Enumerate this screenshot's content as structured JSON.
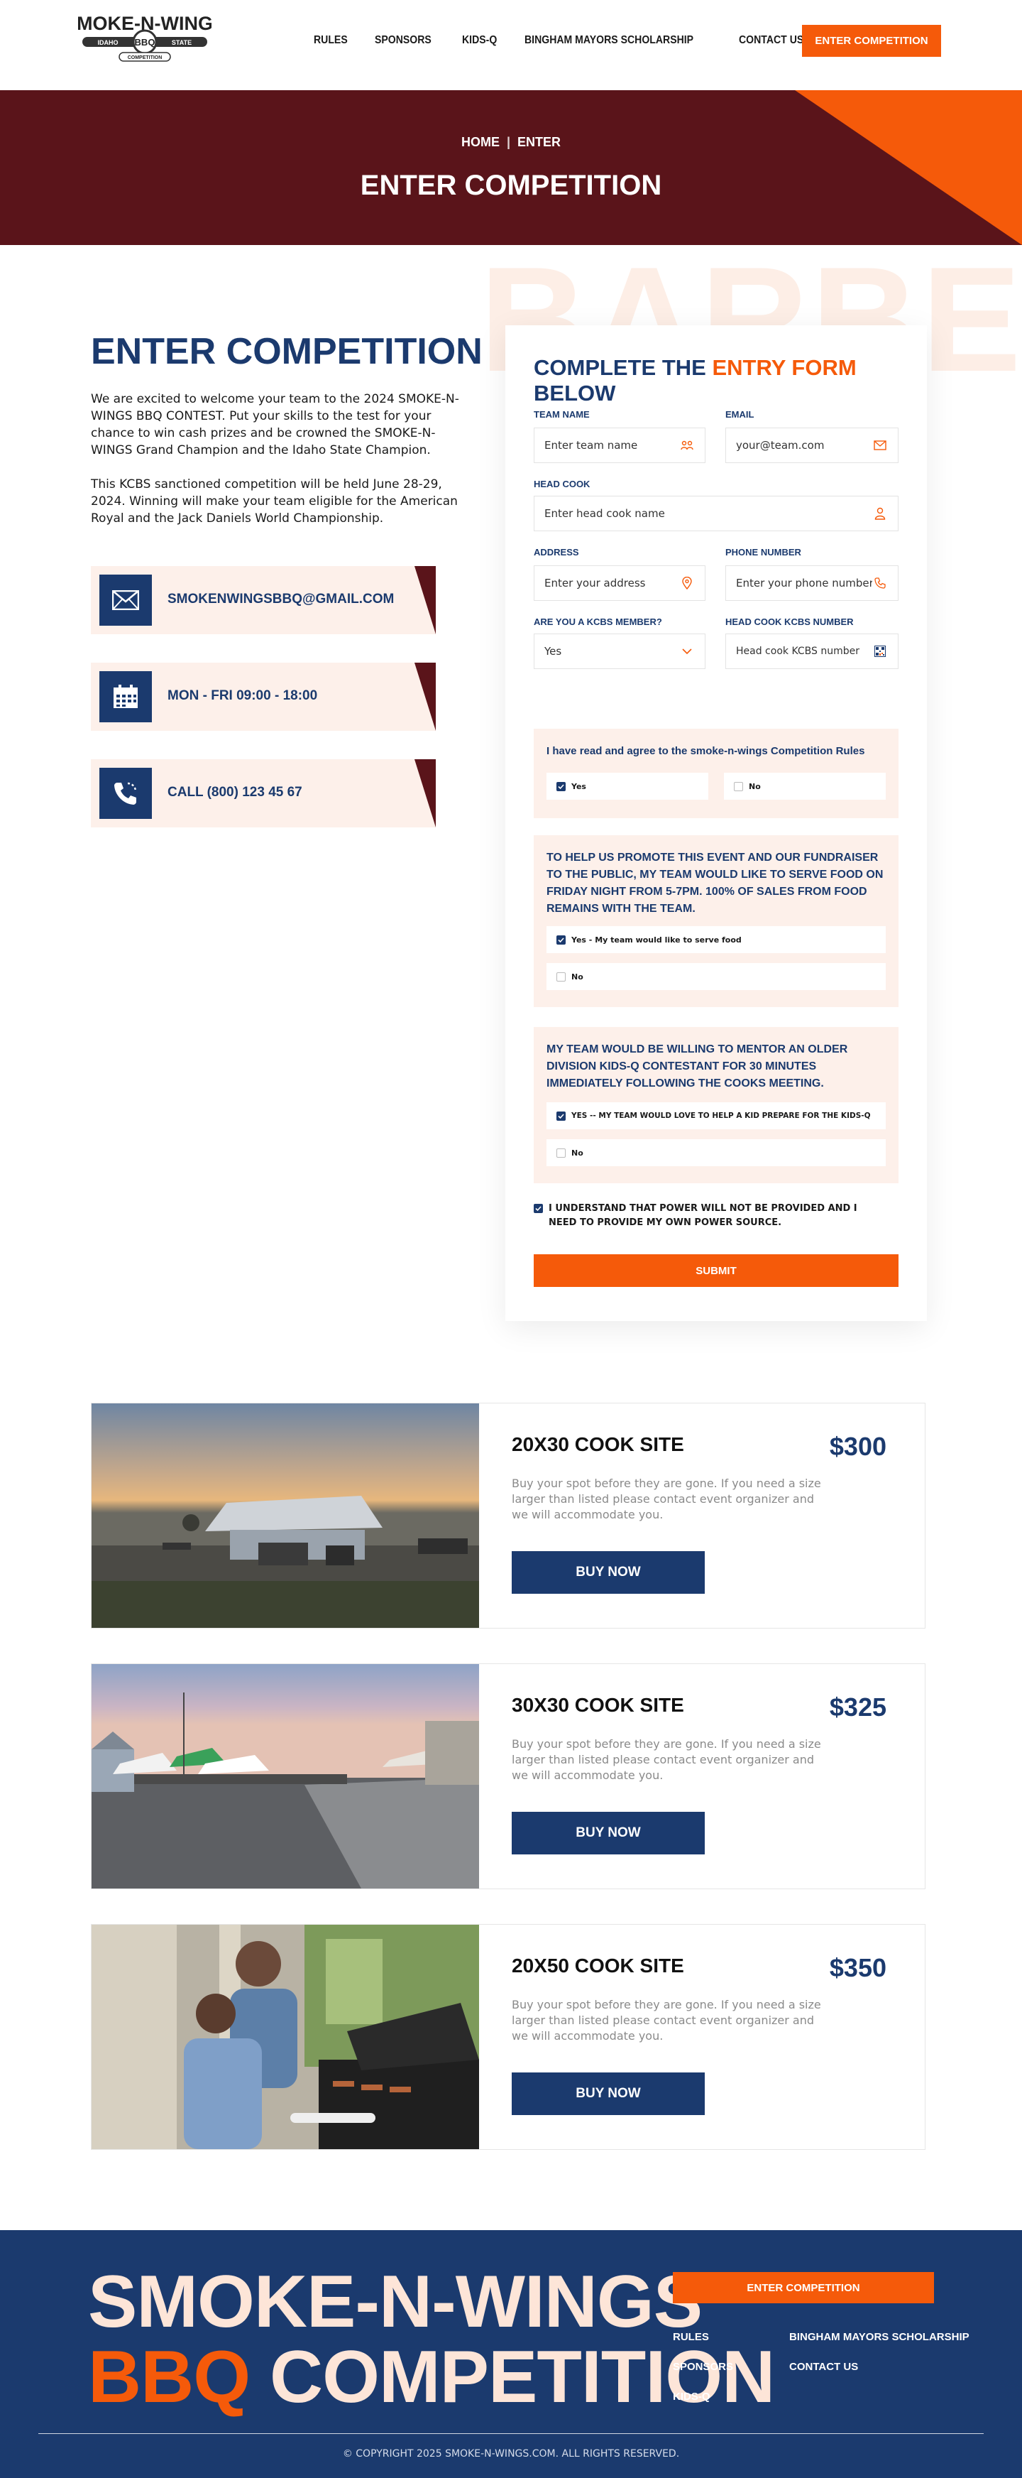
{
  "header": {
    "logo_text": "SMOKE-N-WINGS",
    "logo_sub_left": "IDAHO",
    "logo_sub_center": "BBQ",
    "logo_sub_right": "STATE",
    "logo_sub_bottom": "COMPETITION",
    "nav": [
      "RULES",
      "SPONSORS",
      "KIDS-Q",
      "BINGHAM MAYORS SCHOLARSHIP",
      "CONTACT US"
    ],
    "cta": "ENTER COMPETITION"
  },
  "hero": {
    "crumb_home": "HOME",
    "crumb_sep": "|",
    "crumb_current": "ENTER",
    "title": "ENTER COMPETITION"
  },
  "watermark": "BARBECUE",
  "left": {
    "title": "ENTER COMPETITION",
    "p1": "We are excited to welcome your team to the 2024 SMOKE-N-WINGS BBQ CONTEST. Put your skills to the test for your chance to win cash prizes and be crowned the SMOKE-N-WINGS Grand Champion and the Idaho State Champion.",
    "p2": "This KCBS sanctioned competition will be held June 28-29, 2024. Winning will make your team eligible for the American Royal and the Jack Daniels World Championship.",
    "email": "SMOKENWINGSBBQ@GMAIL.COM",
    "hours": "MON - FRI 09:00 - 18:00",
    "phone": "CALL (800) 123 45 67"
  },
  "form": {
    "title_a": "COMPLETE THE ",
    "title_b": "ENTRY FORM",
    "title_c": " BELOW",
    "team_name_label": "TEAM NAME",
    "team_name_ph": "Enter team name",
    "email_label": "EMAIL",
    "email_ph": "your@team.com",
    "head_cook_label": "HEAD COOK",
    "head_cook_ph": "Enter head cook name",
    "address_label": "ADDRESS",
    "address_ph": "Enter your address",
    "phone_label": "PHONE NUMBER",
    "phone_ph": "Enter your phone number",
    "kcbs_label": "ARE YOU A KCBS MEMBER?",
    "kcbs_value": "Yes",
    "kcbs_num_label": "HEAD COOK KCBS NUMBER",
    "kcbs_num_ph": "Head cook KCBS number",
    "q1": "I have read and agree to the smoke-n-wings Competition Rules",
    "q1_yes": "Yes",
    "q1_no": "No",
    "q2": "TO HELP US PROMOTE THIS EVENT AND OUR FUNDRAISER TO THE PUBLIC, MY TEAM WOULD LIKE TO SERVE FOOD ON FRIDAY NIGHT FROM 5-7PM. 100% OF SALES FROM FOOD REMAINS WITH THE TEAM.",
    "q2_yes": "Yes - My team would like to serve food",
    "q2_no": "No",
    "q3": "MY TEAM WOULD BE WILLING TO MENTOR AN OLDER DIVISION KIDS-Q CONTESTANT FOR 30 MINUTES IMMEDIATELY FOLLOWING THE COOKS MEETING.",
    "q3_yes": "YES -- MY TEAM WOULD LOVE TO HELP A KID PREPARE FOR THE KIDS-Q",
    "q3_no": "No",
    "power": "I UNDERSTAND THAT POWER WILL NOT BE PROVIDED AND I NEED TO PROVIDE MY OWN POWER SOURCE.",
    "submit": "SUBMIT"
  },
  "products": [
    {
      "name": "20X30 COOK SITE",
      "price": "$300",
      "desc": "Buy your spot before they are gone. If you need a size larger than listed please contact event organizer and we will accommodate you.",
      "buy": "BUY NOW"
    },
    {
      "name": "30X30 COOK SITE",
      "price": "$325",
      "desc": "Buy your spot before they are gone. If you need a size larger than listed please contact event organizer and we will accommodate you.",
      "buy": "BUY NOW"
    },
    {
      "name": "20X50 COOK SITE",
      "price": "$350",
      "desc": "Buy your spot before they are gone. If you need a size larger than listed please contact event organizer and we will accommodate you.",
      "buy": "BUY NOW"
    }
  ],
  "footer": {
    "line1": "SMOKE-N-WINGS",
    "line2a": "BBQ",
    "line2b": " COMPETITION",
    "cta": "ENTER COMPETITION",
    "links": [
      "RULES",
      "SPONSORS",
      "KIDS-Q",
      "BINGHAM MAYORS SCHOLARSHIP",
      "CONTACT US"
    ],
    "copyright": "© COPYRIGHT 2025 SMOKE-N-WINGS.COM. ALL RIGHTS RESERVED."
  },
  "colors": {
    "navy": "#1b3a6e",
    "orange": "#f55a0a",
    "maroon": "#5a141a",
    "peach": "#fdf0ea"
  }
}
